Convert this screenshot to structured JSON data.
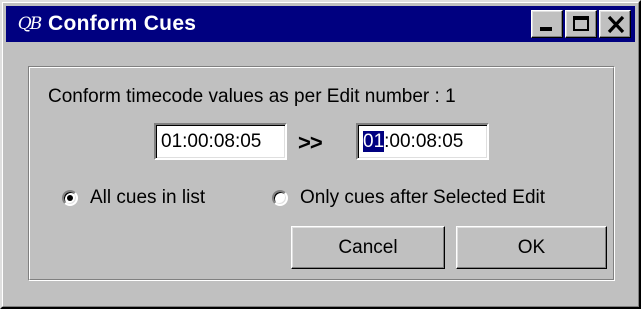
{
  "window": {
    "app_icon": "QB",
    "title": "Conform Cues",
    "controls": [
      "minimize-icon",
      "maximize-icon",
      "close-icon"
    ]
  },
  "dialog": {
    "prompt": "Conform timecode values as per Edit number : 1",
    "from_timecode": "01:00:08:05",
    "arrow": ">>",
    "to_timecode": {
      "selected": "01",
      "rest": ":00:08:05"
    },
    "options": [
      {
        "label": "All cues in list",
        "checked": true
      },
      {
        "label": "Only cues after Selected Edit",
        "checked": false
      }
    ],
    "buttons": {
      "cancel": "Cancel",
      "ok": "OK"
    }
  },
  "colors": {
    "titlebar": "#000080",
    "face": "#c0c0c0",
    "selection": "#000080"
  }
}
